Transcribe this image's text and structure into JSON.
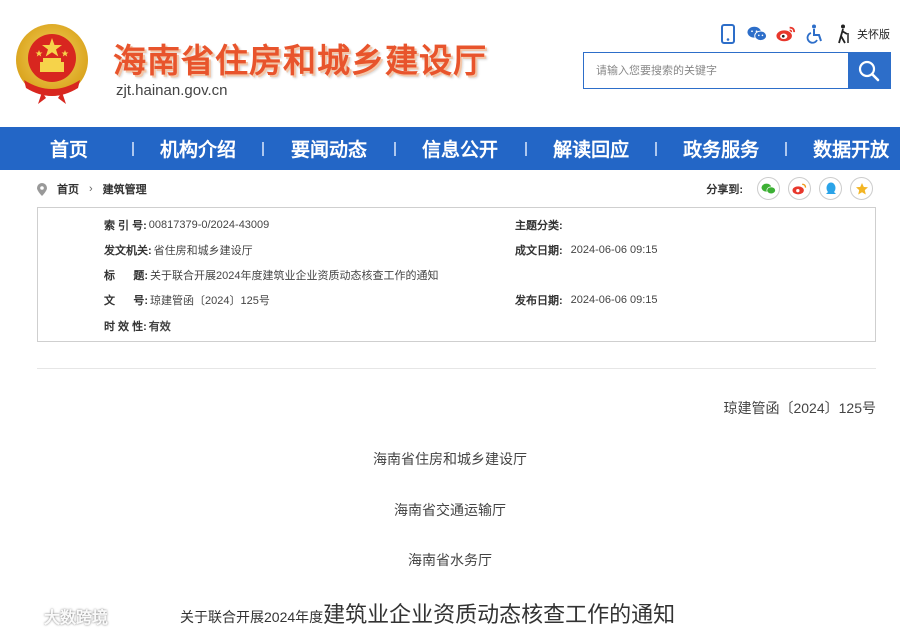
{
  "header": {
    "site_title": "海南省住房和城乡建设厅",
    "site_domain": "zjt.hainan.gov.cn",
    "care_label": "关怀版",
    "search_placeholder": "请输入您要搜索的关键字",
    "icons": [
      "mobile-icon",
      "wechat-icon",
      "weibo-icon",
      "accessibility-icon",
      "elder-care-icon"
    ]
  },
  "nav": {
    "items": [
      "首页",
      "机构介绍",
      "要闻动态",
      "信息公开",
      "解读回应",
      "政务服务",
      "数据开放"
    ]
  },
  "breadcrumb": {
    "home": "首页",
    "current": "建筑管理"
  },
  "share": {
    "label": "分享到:",
    "icons": [
      "wechat-share-icon",
      "weibo-share-icon",
      "qq-share-icon",
      "qzone-share-icon"
    ]
  },
  "meta": {
    "index_key": "索 引 号:",
    "index_val": "00817379-0/2024-43009",
    "topic_key": "主题分类:",
    "topic_val": "",
    "issuer_key": "发文机关:",
    "issuer_val": "省住房和城乡建设厅",
    "date_key": "成文日期:",
    "date_val": "2024-06-06 09:15",
    "title_key": "标      题:",
    "title_val": "关于联合开展2024年度建筑业企业资质动态核查工作的通知",
    "docno_key": "文      号:",
    "docno_val": "琼建管函〔2024〕125号",
    "pubdate_key": "发布日期:",
    "pubdate_val": "2024-06-06 09:15",
    "validity_key": "时 效 性:",
    "validity_val": "有效"
  },
  "document": {
    "number": "琼建管函〔2024〕125号",
    "issuers": [
      "海南省住房和城乡建设厅",
      "海南省交通运输厅",
      "海南省水务厅"
    ],
    "title_small": "关于联合开展2024年度",
    "title_big": "建筑业企业资质动态核查工作的通知"
  },
  "watermark": "大数跨境",
  "colors": {
    "nav_bg": "#2366c6",
    "title_orange": "#e8542c",
    "search_blue": "#2d6ec9"
  }
}
